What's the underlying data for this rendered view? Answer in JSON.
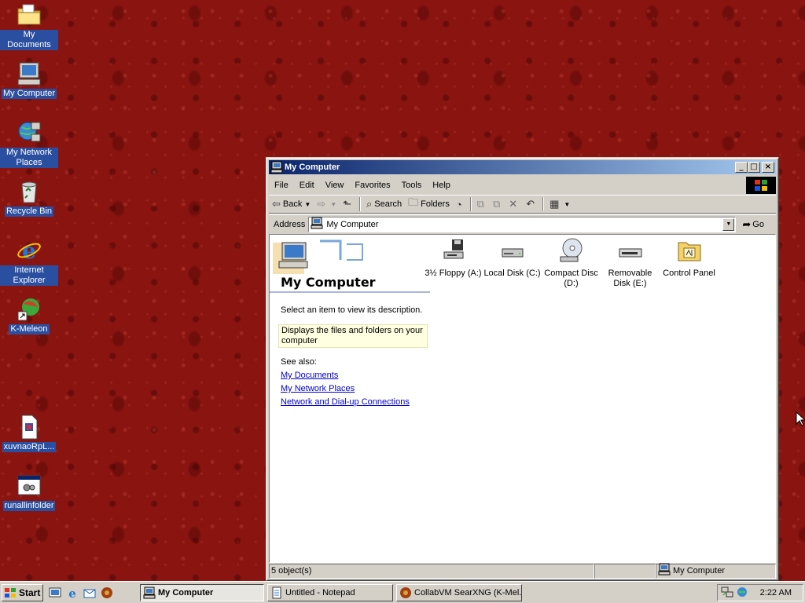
{
  "desktop": {
    "icons": [
      {
        "label": "My Documents",
        "icon": "folder-icon"
      },
      {
        "label": "My Computer",
        "icon": "computer-icon"
      },
      {
        "label": "My Network Places",
        "icon": "network-icon"
      },
      {
        "label": "Recycle Bin",
        "icon": "recycle-bin-icon"
      },
      {
        "label": "Internet Explorer",
        "icon": "ie-icon"
      },
      {
        "label": "K-Meleon",
        "icon": "k-meleon-icon"
      },
      {
        "label": "xuvnaoRpL...",
        "icon": "document-icon"
      },
      {
        "label": "runallinfolder",
        "icon": "batch-icon"
      }
    ]
  },
  "window": {
    "title": "My Computer",
    "menu": [
      "File",
      "Edit",
      "View",
      "Favorites",
      "Tools",
      "Help"
    ],
    "toolbar": {
      "back": "Back",
      "search": "Search",
      "folders": "Folders"
    },
    "address": {
      "label": "Address",
      "value": "My Computer",
      "go": "Go"
    },
    "sidebar": {
      "title": "My Computer",
      "description": "Select an item to view its description.",
      "hint": "Displays the files and folders on your computer",
      "see_also": "See also:",
      "links": [
        "My Documents",
        "My Network Places",
        "Network and Dial-up Connections"
      ]
    },
    "items": [
      {
        "label": "3½ Floppy (A:)",
        "icon": "floppy-drive-icon"
      },
      {
        "label": "Local Disk (C:)",
        "icon": "hard-disk-icon"
      },
      {
        "label": "Compact Disc (D:)",
        "icon": "cd-drive-icon"
      },
      {
        "label": "Removable Disk (E:)",
        "icon": "removable-disk-icon"
      },
      {
        "label": "Control Panel",
        "icon": "control-panel-icon"
      }
    ],
    "status": {
      "count": "5 object(s)",
      "location": "My Computer"
    }
  },
  "taskbar": {
    "start": "Start",
    "tasks": [
      {
        "label": "My Computer",
        "active": true
      },
      {
        "label": "Untitled - Notepad",
        "active": false
      },
      {
        "label": "CollabVM SearXNG (K-Mel...",
        "active": false
      }
    ],
    "clock": "2:22 AM"
  },
  "colors": {
    "desktop": "#8a1410",
    "titlebar_start": "#0a246a",
    "titlebar_end": "#a6caf0",
    "face": "#d4d0c8",
    "link": "#0000cc"
  }
}
